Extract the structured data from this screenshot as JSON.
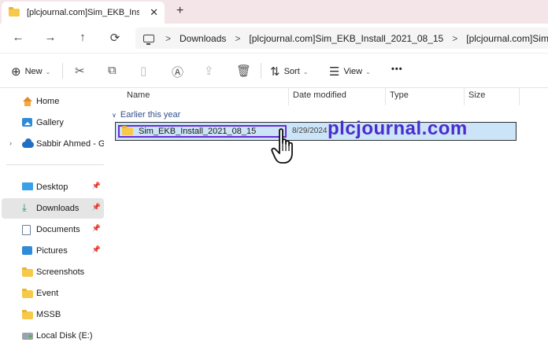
{
  "tab": {
    "title": "[plcjournal.com]Sim_EKB_Insta",
    "close_glyph": "✕",
    "new_tab_glyph": "+"
  },
  "nav": {
    "back": "←",
    "forward": "→",
    "up": "↑",
    "refresh": "⟳"
  },
  "address": {
    "crumbs": [
      "Downloads",
      "[plcjournal.com]Sim_EKB_Install_2021_08_15",
      "[plcjournal.com]Sim"
    ],
    "separator": ">"
  },
  "toolbar": {
    "new_label": "New",
    "sort_label": "Sort",
    "view_label": "View",
    "more_label": "•••",
    "icons": [
      "cut-icon",
      "copy-icon",
      "paste-icon",
      "rename-icon",
      "share-icon",
      "delete-icon"
    ]
  },
  "sidebar": {
    "items": [
      {
        "label": "Home",
        "icon": "home-icon"
      },
      {
        "label": "Gallery",
        "icon": "gallery-icon"
      },
      {
        "label": "Sabbir Ahmed - Glo",
        "icon": "cloud-icon"
      },
      {
        "label": "Desktop",
        "icon": "desktop-icon",
        "pinned": true
      },
      {
        "label": "Downloads",
        "icon": "download-icon",
        "pinned": true,
        "active": true
      },
      {
        "label": "Documents",
        "icon": "documents-icon",
        "pinned": true
      },
      {
        "label": "Pictures",
        "icon": "pictures-icon",
        "pinned": true
      },
      {
        "label": "Screenshots",
        "icon": "folder-icon"
      },
      {
        "label": "Event",
        "icon": "folder-icon"
      },
      {
        "label": "MSSB",
        "icon": "folder-icon"
      },
      {
        "label": "Local Disk (E:)",
        "icon": "disk-icon"
      }
    ]
  },
  "columns": {
    "name": "Name",
    "date_modified": "Date modified",
    "type": "Type",
    "size": "Size"
  },
  "group": {
    "title": "Earlier this year"
  },
  "files": [
    {
      "name": "Sim_EKB_Install_2021_08_15",
      "date": "8/29/2024",
      "icon": "folder-icon",
      "selected": true
    }
  ],
  "watermark": {
    "text": "plcjournal.com"
  },
  "colors": {
    "tabbar_bg": "#f3e5e8",
    "selection_bg": "#cce4f7",
    "highlight_border": "#6a2cd6",
    "watermark": "#4a2ccf"
  }
}
